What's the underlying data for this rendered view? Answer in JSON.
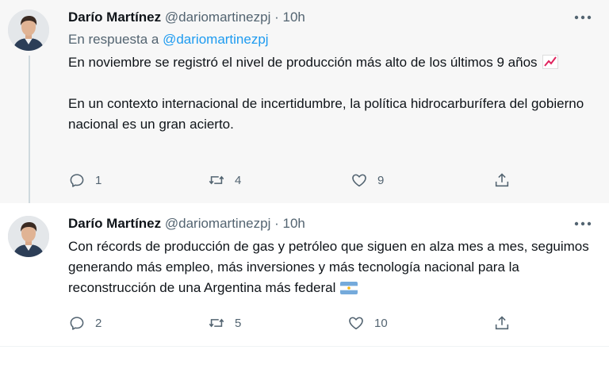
{
  "tweets": [
    {
      "author_name": "Darío Martínez",
      "author_handle": "@dariomartinezpj",
      "separator": "·",
      "time": "10h",
      "reply_prefix": "En respuesta a",
      "reply_mention": "@dariomartinezpj",
      "paragraph1": "En noviembre se registró el nivel de producción más alto de los últimos 9 años",
      "emoji1": "chart-increasing-emoji",
      "paragraph2": "En un contexto internacional de incertidumbre, la política hidrocarburífera del gobierno nacional es un gran acierto.",
      "reply_count": "1",
      "retweet_count": "4",
      "like_count": "9"
    },
    {
      "author_name": "Darío Martínez",
      "author_handle": "@dariomartinezpj",
      "separator": "·",
      "time": "10h",
      "text": "Con récords de producción de gas y petróleo que siguen en alza mes a mes, seguimos generando más empleo, más inversiones y más tecnología nacional para la reconstrucción de una Argentina más federal",
      "emoji": "argentina-flag-emoji",
      "reply_count": "2",
      "retweet_count": "5",
      "like_count": "10"
    }
  ],
  "colors": {
    "accent": "#1d9bf0",
    "muted": "#536471",
    "text": "#0f1419",
    "highlight_bg": "#f7f7f7"
  }
}
